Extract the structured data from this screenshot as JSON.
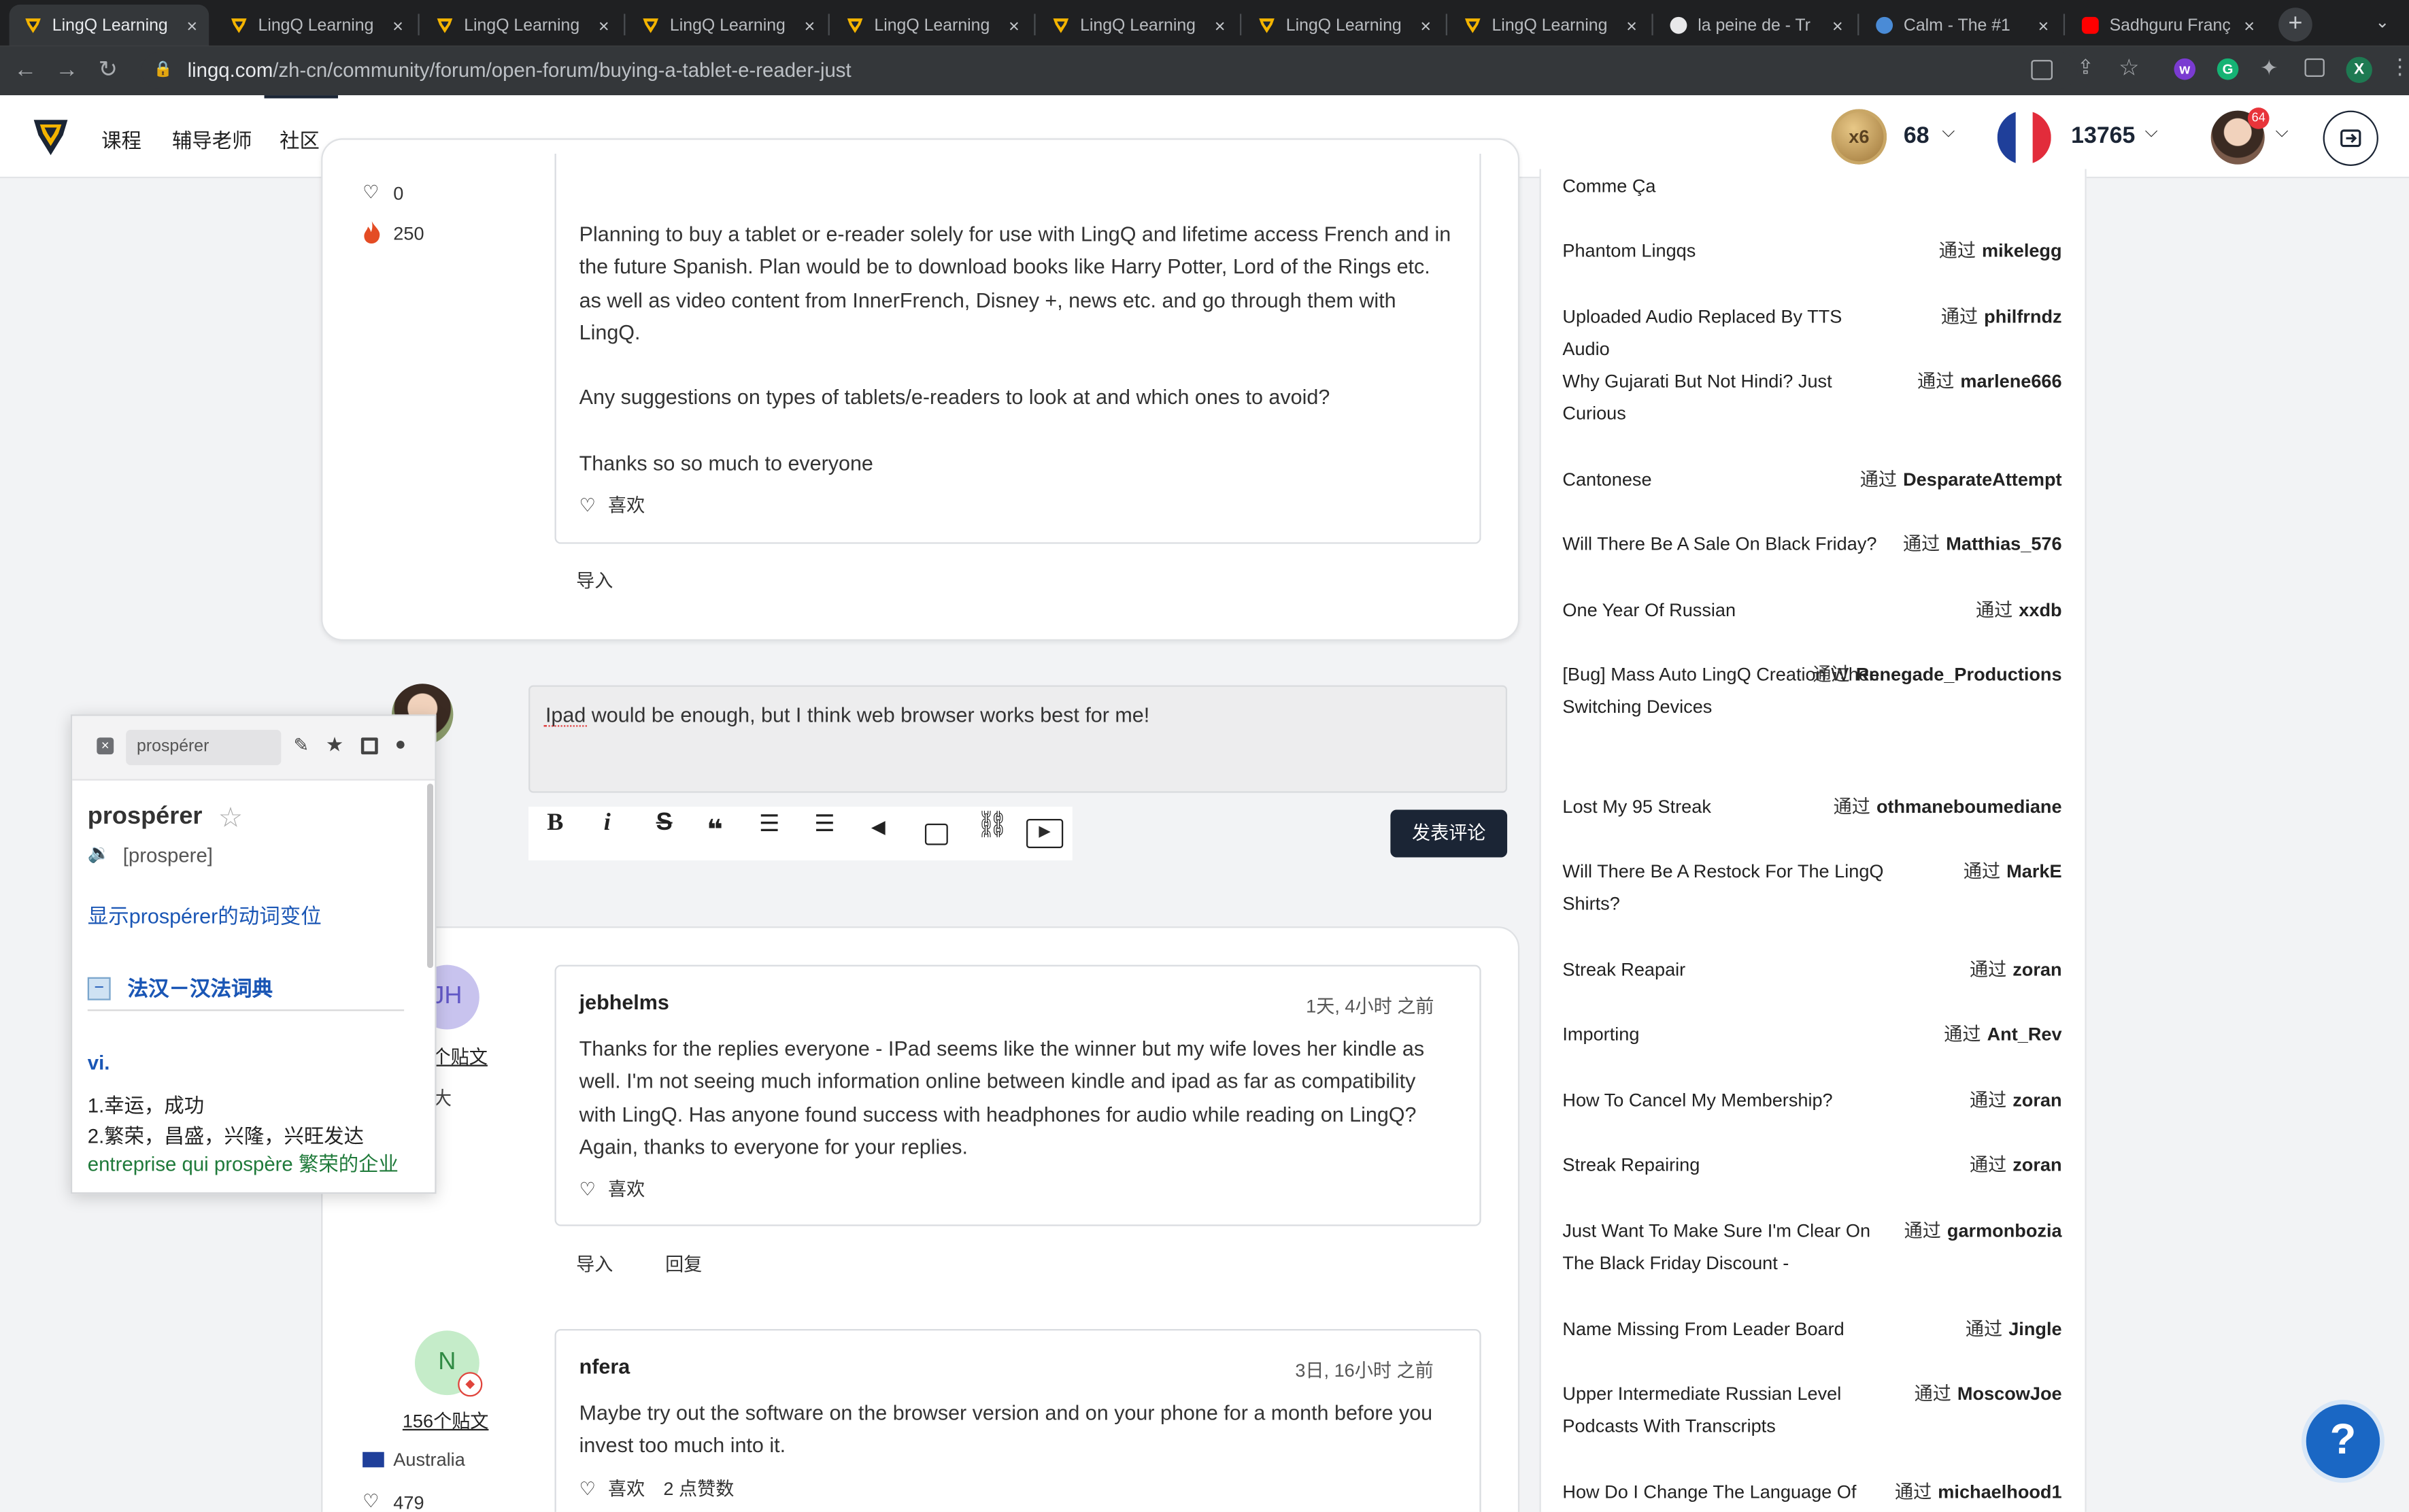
{
  "browser": {
    "tabs": [
      {
        "title": "LingQ Learning",
        "active": true,
        "icon": "lingq-icon"
      },
      {
        "title": "LingQ Learning",
        "icon": "lingq-icon"
      },
      {
        "title": "LingQ Learning",
        "icon": "lingq-icon"
      },
      {
        "title": "LingQ Learning",
        "icon": "lingq-icon"
      },
      {
        "title": "LingQ Learning",
        "icon": "lingq-icon"
      },
      {
        "title": "LingQ Learning",
        "icon": "lingq-icon"
      },
      {
        "title": "LingQ Learning",
        "icon": "lingq-icon"
      },
      {
        "title": "LingQ Learning",
        "icon": "lingq-icon"
      },
      {
        "title": "la peine de - Tr",
        "icon": "reverso-icon"
      },
      {
        "title": "Calm - The #1",
        "icon": "calm-icon"
      },
      {
        "title": "Sadhguru Franç",
        "icon": "youtube-icon"
      }
    ],
    "close_glyph": "×",
    "new_tab_glyph": "+",
    "url_domain": "lingq.com",
    "url_path": "/zh-cn/community/forum/open-forum/buying-a-tablet-e-reader-just",
    "ext_letter": "X"
  },
  "header": {
    "nav": [
      "课程",
      "辅导老师",
      "社区"
    ],
    "streak_multiplier": "x6",
    "coins": "68",
    "known_words": "13765",
    "notification_count": "64"
  },
  "original_post": {
    "likes": "0",
    "streak": "250",
    "paragraphs": [
      "Planning to buy a tablet or e-reader solely for use with LingQ and lifetime access French and in the future Spanish. Plan would be to download books like Harry Potter, Lord of the Rings etc. as well as video content from InnerFrench, Disney +, news etc. and go through them with LingQ.",
      "Any suggestions on types of tablets/e-readers to look at and which ones to avoid?",
      "Thanks so so much to everyone"
    ],
    "like_label": "喜欢",
    "import_label": "导入"
  },
  "reply_box": {
    "text": "Ipad would be enough, but I think web browser works best for me!",
    "submit_label": "发表评论"
  },
  "replies": [
    {
      "author": "jebhelms",
      "avatar_initials": "JH",
      "posts_label": "22个贴文",
      "country": "大",
      "time": "1天, 4小时 之前",
      "text": "Thanks for the replies everyone - IPad seems like the winner but my wife loves her kindle as well. I'm not seeing much information online between kindle and ipad as far as compatibility with LingQ. Has anyone found success with headphones for audio while reading on LingQ? Again, thanks to everyone for your replies.",
      "like_label": "喜欢",
      "import_label": "导入",
      "reply_label": "回复"
    },
    {
      "author": "nfera",
      "avatar_initials": "N",
      "posts_label": "156个贴文",
      "country": "Australia",
      "likes": "479",
      "time": "3日, 16小时 之前",
      "text": "Maybe try out the software on the browser version and on your phone for a month before you invest too much into it.",
      "like_label": "喜欢",
      "likes_count_label": "2 点赞数"
    }
  ],
  "sidebar": {
    "by_prefix": "通过",
    "threads": [
      {
        "title": "Comme Ça",
        "author": ""
      },
      {
        "title": "Phantom Lingqs",
        "author": "mikelegg"
      },
      {
        "title": "Uploaded Audio Replaced By TTS Audio",
        "author": "philfrndz"
      },
      {
        "title": "Why Gujarati But Not Hindi? Just Curious",
        "author": "marlene666"
      },
      {
        "title": "Cantonese",
        "author": "DesparateAttempt"
      },
      {
        "title": "Will There Be A Sale On Black Friday?",
        "author": "Matthias_576"
      },
      {
        "title": "One Year Of Russian",
        "author": "xxdb"
      },
      {
        "title": "[Bug] Mass Auto LingQ Creation When Switching Devices",
        "author": "Renegade_Productions"
      },
      {
        "title": "Lost My 95 Streak",
        "author": "othmaneboumediane"
      },
      {
        "title": "Will There Be A Restock For The LingQ Shirts?",
        "author": "MarkE"
      },
      {
        "title": "Streak Reapair",
        "author": "zoran"
      },
      {
        "title": "Importing",
        "author": "Ant_Rev"
      },
      {
        "title": "How To Cancel My Membership?",
        "author": "zoran"
      },
      {
        "title": "Streak Repairing",
        "author": "zoran"
      },
      {
        "title": "Just Want To Make Sure I'm Clear On The Black Friday Discount -",
        "author": "garmonbozia"
      },
      {
        "title": "Name Missing From Leader Board",
        "author": "Jingle"
      },
      {
        "title": "Upper Intermediate Russian Level Podcasts With Transcripts",
        "author": "MoscowJoe"
      },
      {
        "title": "How Do I Change The Language Of",
        "author": "michaelhood1"
      }
    ]
  },
  "dictionary_popup": {
    "search_value": "prospérer",
    "word": "prospérer",
    "phonetic": "[prospere]",
    "conjugation_link": "显示prospérer的动词变位",
    "dict_name": "法汉－汉法词典",
    "pos": "vi.",
    "senses": [
      "1.幸运，成功",
      "2.繁荣，昌盛，兴隆，兴旺发达"
    ],
    "example_fr": "entreprise qui prospère",
    "example_zh": "繁荣的企业"
  },
  "help_glyph": "?",
  "colors": {
    "accent_dark": "#1b2535",
    "link_blue": "#1a56b5",
    "green": "#1f7a3a",
    "help_blue": "#1a67c4",
    "streak_red": "#e44c24"
  }
}
